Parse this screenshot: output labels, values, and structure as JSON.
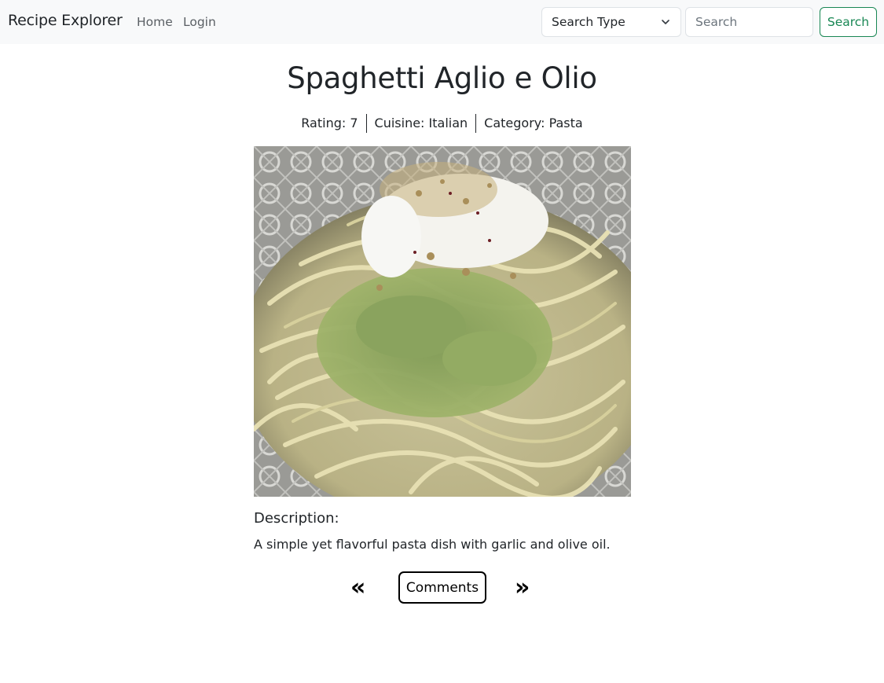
{
  "navbar": {
    "brand": "Recipe Explorer",
    "links": [
      "Home",
      "Login"
    ],
    "search_type": {
      "selected": "Search Type"
    },
    "search_input": {
      "placeholder": "Search",
      "value": ""
    },
    "search_button": "Search",
    "accent_color": "#198754"
  },
  "recipe": {
    "title": "Spaghetti Aglio e Olio",
    "rating": "Rating: 7",
    "cuisine": "Cuisine: Italian",
    "category": "Category: Pasta",
    "image_icon": "pasta-photo",
    "description_heading": "Description:",
    "description": "A simple yet flavorful pasta dish with garlic and olive oil."
  },
  "pager": {
    "prev": "«",
    "comments": "Comments",
    "next": "»"
  }
}
